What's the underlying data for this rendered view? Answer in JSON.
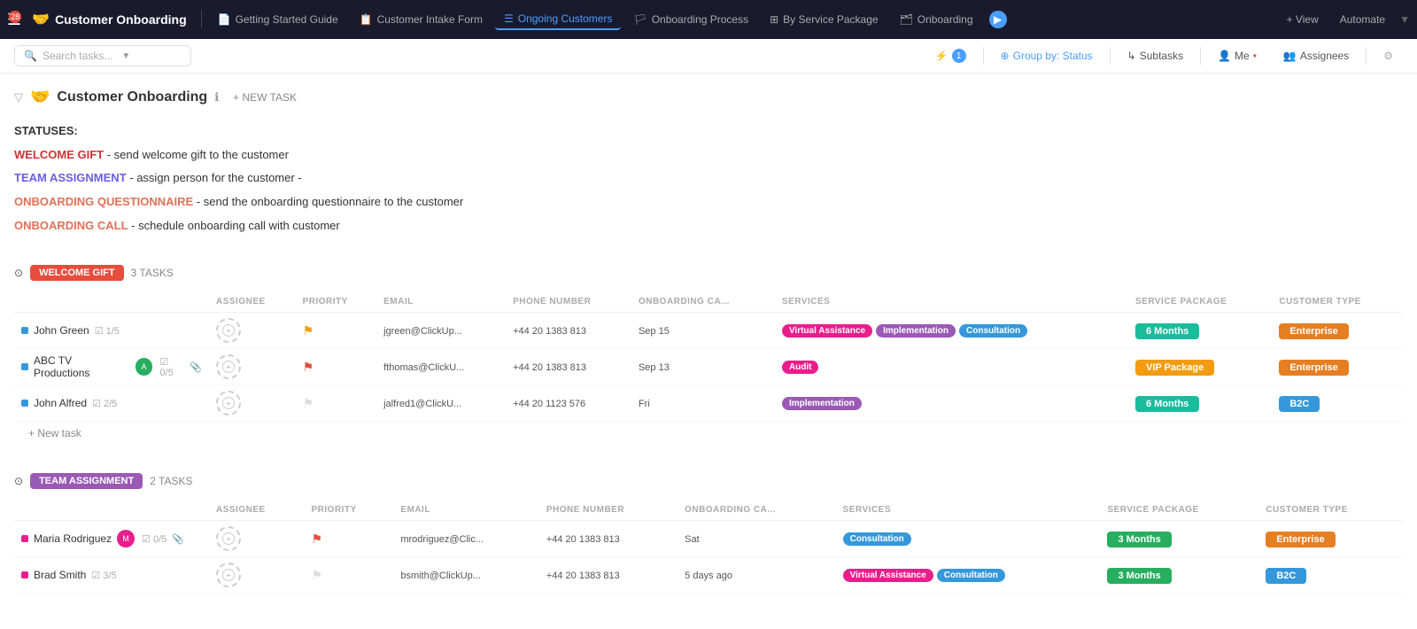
{
  "nav": {
    "badge": "28",
    "logo": "Customer Onboarding",
    "logo_emoji": "🤝",
    "tabs": [
      {
        "id": "getting-started",
        "label": "Getting Started Guide",
        "icon": "📄",
        "active": false
      },
      {
        "id": "intake-form",
        "label": "Customer Intake Form",
        "icon": "📋",
        "active": false
      },
      {
        "id": "ongoing-customers",
        "label": "Ongoing Customers",
        "icon": "☰",
        "active": true
      },
      {
        "id": "onboarding-process",
        "label": "Onboarding Process",
        "icon": "🏳",
        "active": false
      },
      {
        "id": "by-service",
        "label": "By Service Package",
        "icon": "⊞",
        "active": false
      },
      {
        "id": "onboarding",
        "label": "Onboarding",
        "icon": "🗂",
        "active": false
      }
    ],
    "view_btn": "+ View",
    "automate_btn": "Automate"
  },
  "toolbar": {
    "search_placeholder": "Search tasks...",
    "filter_count": "1",
    "group_by": "Group by: Status",
    "subtasks": "Subtasks",
    "me": "Me",
    "assignees": "Assignees"
  },
  "page": {
    "emoji": "🤝",
    "title": "Customer Onboarding",
    "new_task_label": "+ NEW TASK"
  },
  "statuses_heading": "STATUSES:",
  "statuses": [
    {
      "label": "WELCOME GIFT",
      "color": "welcome",
      "desc": "- send welcome gift to the customer"
    },
    {
      "label": "TEAM ASSIGNMENT",
      "color": "team",
      "desc": "- assign person for the customer -"
    },
    {
      "label": "ONBOARDING QUESTIONNAIRE",
      "color": "questionnaire",
      "desc": "- send the onboarding questionnaire to the customer"
    },
    {
      "label": "ONBOARDING CALL",
      "color": "call",
      "desc": "- schedule onboarding call with customer"
    }
  ],
  "sections": [
    {
      "id": "welcome-gift",
      "badge_label": "WELCOME GIFT",
      "badge_class": "badge-welcome",
      "task_count": "3 TASKS",
      "columns": [
        "",
        "ASSIGNEE",
        "PRIORITY",
        "EMAIL",
        "PHONE NUMBER",
        "ONBOARDING CA...",
        "SERVICES",
        "SERVICE PACKAGE",
        "CUSTOMER TYPE"
      ],
      "tasks": [
        {
          "name": "John Green",
          "dot_class": "dot-blue",
          "progress": "1/5",
          "has_avatar": false,
          "avatar_letter": "",
          "has_attachment": false,
          "priority": "yellow",
          "email": "jgreen@ClickUp...",
          "phone": "+44 20 1383 813",
          "onboarding": "Sep 15",
          "services": [
            {
              "label": "Virtual Assistance",
              "cls": "tag-virtual"
            },
            {
              "label": "Implementation",
              "cls": "tag-implementation"
            },
            {
              "label": "Consultation",
              "cls": "tag-consultation"
            }
          ],
          "package": "6 Months",
          "package_cls": "pkg-6months",
          "ctype": "Enterprise",
          "ctype_cls": "ctype-enterprise"
        },
        {
          "name": "ABC TV Productions",
          "dot_class": "dot-blue",
          "progress": "0/5",
          "has_avatar": true,
          "avatar_letter": "A",
          "has_attachment": true,
          "priority": "red",
          "email": "fthomas@ClickU...",
          "phone": "+44 20 1383 813",
          "onboarding": "Sep 13",
          "services": [
            {
              "label": "Audit",
              "cls": "tag-audit"
            }
          ],
          "package": "VIP Package",
          "package_cls": "pkg-vip",
          "ctype": "Enterprise",
          "ctype_cls": "ctype-enterprise"
        },
        {
          "name": "John Alfred",
          "dot_class": "dot-blue",
          "progress": "2/5",
          "has_avatar": false,
          "avatar_letter": "",
          "has_attachment": false,
          "priority": "gray",
          "email": "jalfred1@ClickU...",
          "phone": "+44 20 1123 576",
          "onboarding": "Fri",
          "services": [
            {
              "label": "Implementation",
              "cls": "tag-implementation"
            }
          ],
          "package": "6 Months",
          "package_cls": "pkg-6months",
          "ctype": "B2C",
          "ctype_cls": "ctype-b2c"
        }
      ],
      "new_task_label": "+ New task"
    },
    {
      "id": "team-assignment",
      "badge_label": "TEAM ASSIGNMENT",
      "badge_class": "badge-team",
      "task_count": "2 TASKS",
      "columns": [
        "",
        "ASSIGNEE",
        "PRIORITY",
        "EMAIL",
        "PHONE NUMBER",
        "ONBOARDING CA...",
        "SERVICES",
        "SERVICE PACKAGE",
        "CUSTOMER TYPE"
      ],
      "tasks": [
        {
          "name": "Maria Rodriguez",
          "dot_class": "dot-pink",
          "progress": "0/5",
          "has_avatar": true,
          "avatar_letter": "M",
          "has_attachment": true,
          "priority": "red",
          "email": "mrodriguez@Clic...",
          "phone": "+44 20 1383 813",
          "onboarding": "Sat",
          "services": [
            {
              "label": "Consultation",
              "cls": "tag-consultation"
            }
          ],
          "package": "3 Months",
          "package_cls": "pkg-3months",
          "ctype": "Enterprise",
          "ctype_cls": "ctype-enterprise"
        },
        {
          "name": "Brad Smith",
          "dot_class": "dot-pink",
          "progress": "3/5",
          "has_avatar": false,
          "avatar_letter": "",
          "has_attachment": false,
          "priority": "gray",
          "email": "bsmith@ClickUp...",
          "phone": "+44 20 1383 813",
          "onboarding": "5 days ago",
          "services": [
            {
              "label": "Virtual Assistance",
              "cls": "tag-virtual"
            },
            {
              "label": "Consultation",
              "cls": "tag-consultation"
            }
          ],
          "package": "3 Months",
          "package_cls": "pkg-3months",
          "ctype": "B2C",
          "ctype_cls": "ctype-b2c"
        }
      ],
      "new_task_label": ""
    }
  ]
}
